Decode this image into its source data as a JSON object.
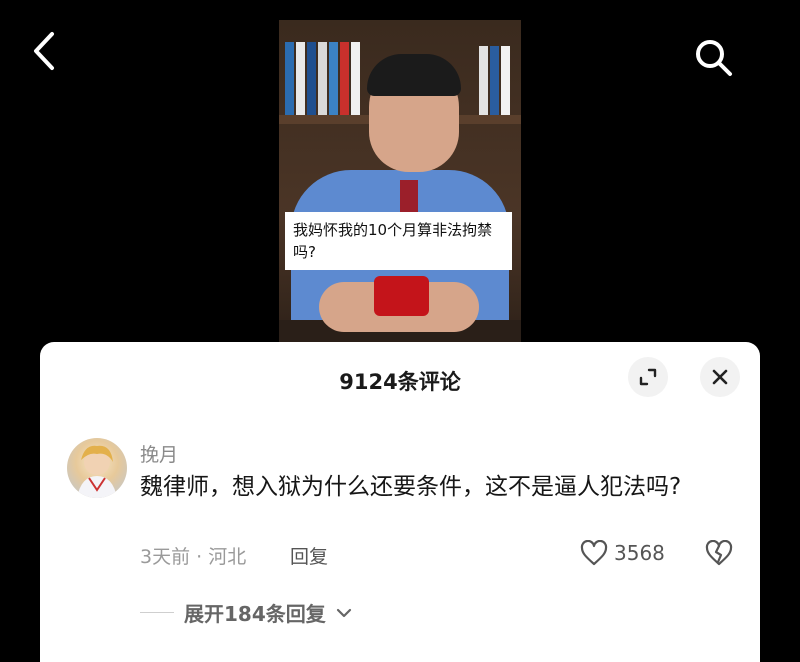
{
  "nav": {
    "back_icon": "back-arrow-icon",
    "search_icon": "search-icon"
  },
  "video": {
    "caption": "我妈怀我的10个月算非法拘禁吗?"
  },
  "comments_sheet": {
    "title": "9124条评论",
    "expand_icon": "expand-icon",
    "close_icon": "close-icon",
    "comment": {
      "username": "挽月",
      "text": "魏律师，想入狱为什么还要条件，这不是逼人犯法吗?",
      "time_location": "3天前 · 河北",
      "reply_label": "回复",
      "like_count": "3568",
      "like_icon": "heart-icon",
      "dislike_icon": "broken-heart-icon",
      "expand_replies": "展开184条回复"
    }
  },
  "colors": {
    "background": "#000000",
    "sheet": "#ffffff",
    "secondary_text": "#9a9a9a"
  }
}
